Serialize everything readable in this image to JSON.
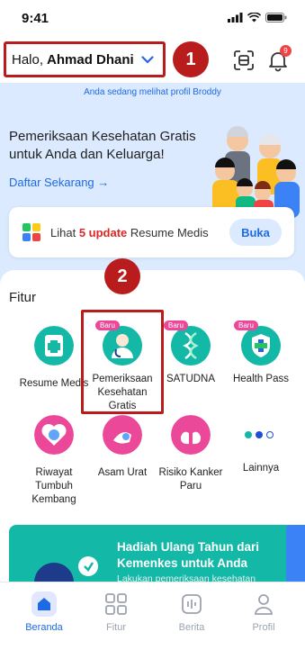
{
  "status": {
    "time": "9:41"
  },
  "header": {
    "greeting": "Halo,",
    "name": "Ahmad Dhani",
    "notif_count": "9"
  },
  "steps": {
    "one": "1",
    "two": "2"
  },
  "profile_notice": "Anda sedang melihat profil Broddy",
  "hero": {
    "title": "Pemeriksaan Kesehatan Gratis untuk Anda dan Keluarga!",
    "link": "Daftar Sekarang →"
  },
  "update_card": {
    "prefix": "Lihat",
    "highlight": "5 update",
    "suffix": "Resume Medis",
    "button": "Buka"
  },
  "fitur": {
    "title": "Fitur",
    "badge": "Baru",
    "items": [
      {
        "label": "Resume Medis"
      },
      {
        "label": "Pemeriksaan Kesehatan Gratis"
      },
      {
        "label": "SATUDNA"
      },
      {
        "label": "Health Pass"
      },
      {
        "label": "Riwayat Tumbuh Kembang"
      },
      {
        "label": "Asam Urat"
      },
      {
        "label": "Risiko Kanker Paru"
      },
      {
        "label": "Lainnya"
      }
    ]
  },
  "promo": {
    "title": "Hadiah Ulang Tahun dari Kemenkes untuk Anda",
    "desc": "Lakukan pemeriksaan kesehatan"
  },
  "nav": [
    {
      "label": "Beranda"
    },
    {
      "label": "Fitur"
    },
    {
      "label": "Berita"
    },
    {
      "label": "Profil"
    }
  ],
  "colors": {
    "accent": "#1d6ae5",
    "highlight_red": "#b91c1c",
    "hero_bg": "#dbeafe",
    "promo_bg": "#14b8a6"
  }
}
